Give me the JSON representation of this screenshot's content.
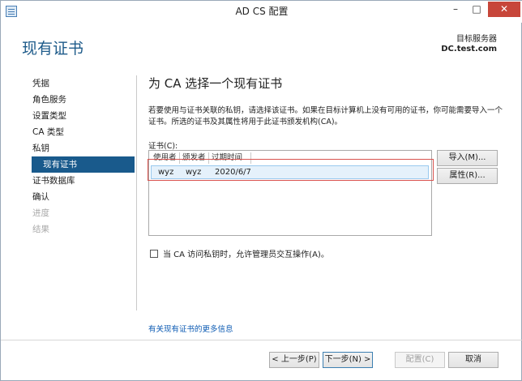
{
  "window": {
    "title": "AD CS 配置"
  },
  "header": {
    "page_title": "现有证书",
    "target_label": "目标服务器",
    "target_server": "DC.test.com"
  },
  "sidebar": {
    "items": [
      {
        "label": "凭据",
        "state": "normal"
      },
      {
        "label": "角色服务",
        "state": "normal"
      },
      {
        "label": "设置类型",
        "state": "normal"
      },
      {
        "label": "CA 类型",
        "state": "normal"
      },
      {
        "label": "私钥",
        "state": "normal"
      },
      {
        "label": "现有证书",
        "state": "active"
      },
      {
        "label": "证书数据库",
        "state": "normal"
      },
      {
        "label": "确认",
        "state": "normal"
      },
      {
        "label": "进度",
        "state": "disabled"
      },
      {
        "label": "结果",
        "state": "disabled"
      }
    ]
  },
  "main": {
    "section_title": "为 CA 选择一个现有证书",
    "description": "若要使用与证书关联的私钥，请选择该证书。如果在目标计算机上没有可用的证书，你可能需要导入一个证书。所选的证书及其属性将用于此证书颁发机构(CA)。",
    "cert_label": "证书(C):",
    "columns": [
      "使用者",
      "颁发者",
      "过期时间"
    ],
    "rows": [
      {
        "subject": "wyz",
        "issuer": "wyz",
        "expires": "2020/6/7"
      }
    ],
    "import_button": "导入(M)...",
    "properties_button": "属性(R)...",
    "checkbox_label": "当 CA 访问私钥时，允许管理员交互操作(A)。",
    "more_link": "有关现有证书的更多信息"
  },
  "footer": {
    "prev": "< 上一步(P)",
    "next": "下一步(N) >",
    "configure": "配置(C)",
    "cancel": "取消"
  },
  "colors": {
    "accent": "#195a8c",
    "title_blue": "#1e5b8a",
    "close_red": "#c7463a",
    "annotation_red": "#d9534f"
  }
}
